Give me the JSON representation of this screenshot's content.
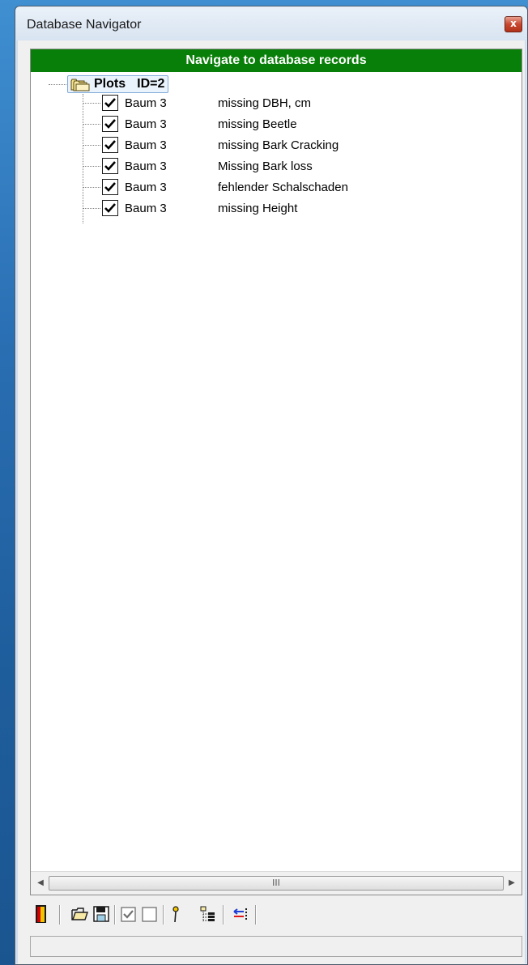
{
  "window": {
    "title": "Database Navigator",
    "close_glyph": "x"
  },
  "panel": {
    "header": "Navigate to database records",
    "header_color": "#087f08"
  },
  "tree": {
    "root": {
      "icon": "folders-icon",
      "label": "Plots",
      "id_text": "ID=2"
    },
    "items": [
      {
        "name": "Baum 3",
        "desc": "missing DBH, cm",
        "checked": true
      },
      {
        "name": "Baum 3",
        "desc": "missing Beetle",
        "checked": true
      },
      {
        "name": "Baum 3",
        "desc": "missing Bark Cracking",
        "checked": true
      },
      {
        "name": "Baum 3",
        "desc": "Missing Bark loss",
        "checked": true
      },
      {
        "name": "Baum 3",
        "desc": "fehlender Schalschaden",
        "checked": true
      },
      {
        "name": "Baum 3",
        "desc": "missing Height",
        "checked": true
      }
    ]
  },
  "scrollbar": {
    "left_arrow": "◀",
    "right_arrow": "▶",
    "thumb_grip": "III"
  },
  "toolbar": {
    "buttons": [
      "exit-door-icon",
      "open-folder-icon",
      "save-disk-icon",
      "check-all-icon",
      "uncheck-all-icon",
      "pin-icon",
      "tree-expand-icon",
      "transfer-arrows-icon"
    ]
  },
  "statusbar": {
    "text": ""
  }
}
